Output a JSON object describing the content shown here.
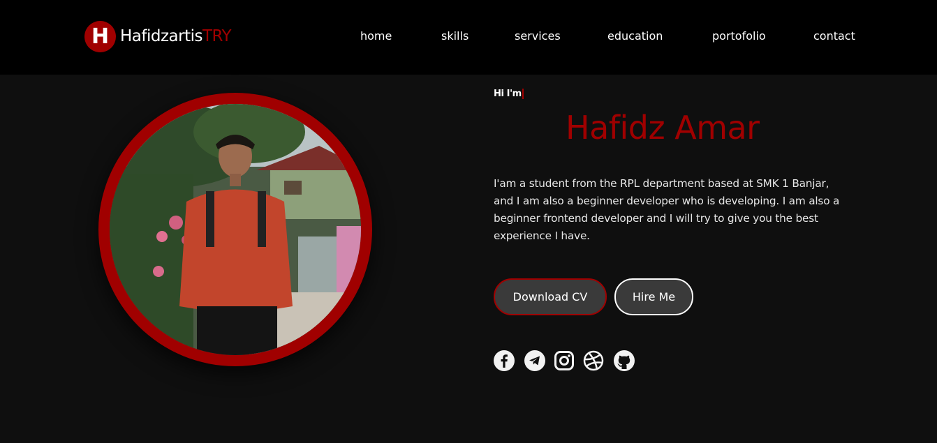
{
  "header": {
    "logo_letter": "H",
    "brand_main": "Hafidzartis",
    "brand_accent": "TRY",
    "nav": [
      "home",
      "skills",
      "services",
      "education",
      "portofolio",
      "contact"
    ]
  },
  "hero": {
    "greeting": "Hi I'm",
    "name": "Hafidz Amar",
    "bio": "I'am a student from the RPL department based at SMK 1 Banjar, and I am also a beginner developer who is developing. I am also a beginner frontend developer and I will try to give you the best experience I have.",
    "buttons": {
      "download_cv": "Download CV",
      "hire_me": "Hire Me"
    },
    "social_icons": [
      "facebook-icon",
      "telegram-icon",
      "instagram-icon",
      "dribbble-icon",
      "github-icon"
    ]
  },
  "colors": {
    "accent": "#a00000",
    "background": "#0f0f0f",
    "header": "#000000"
  }
}
